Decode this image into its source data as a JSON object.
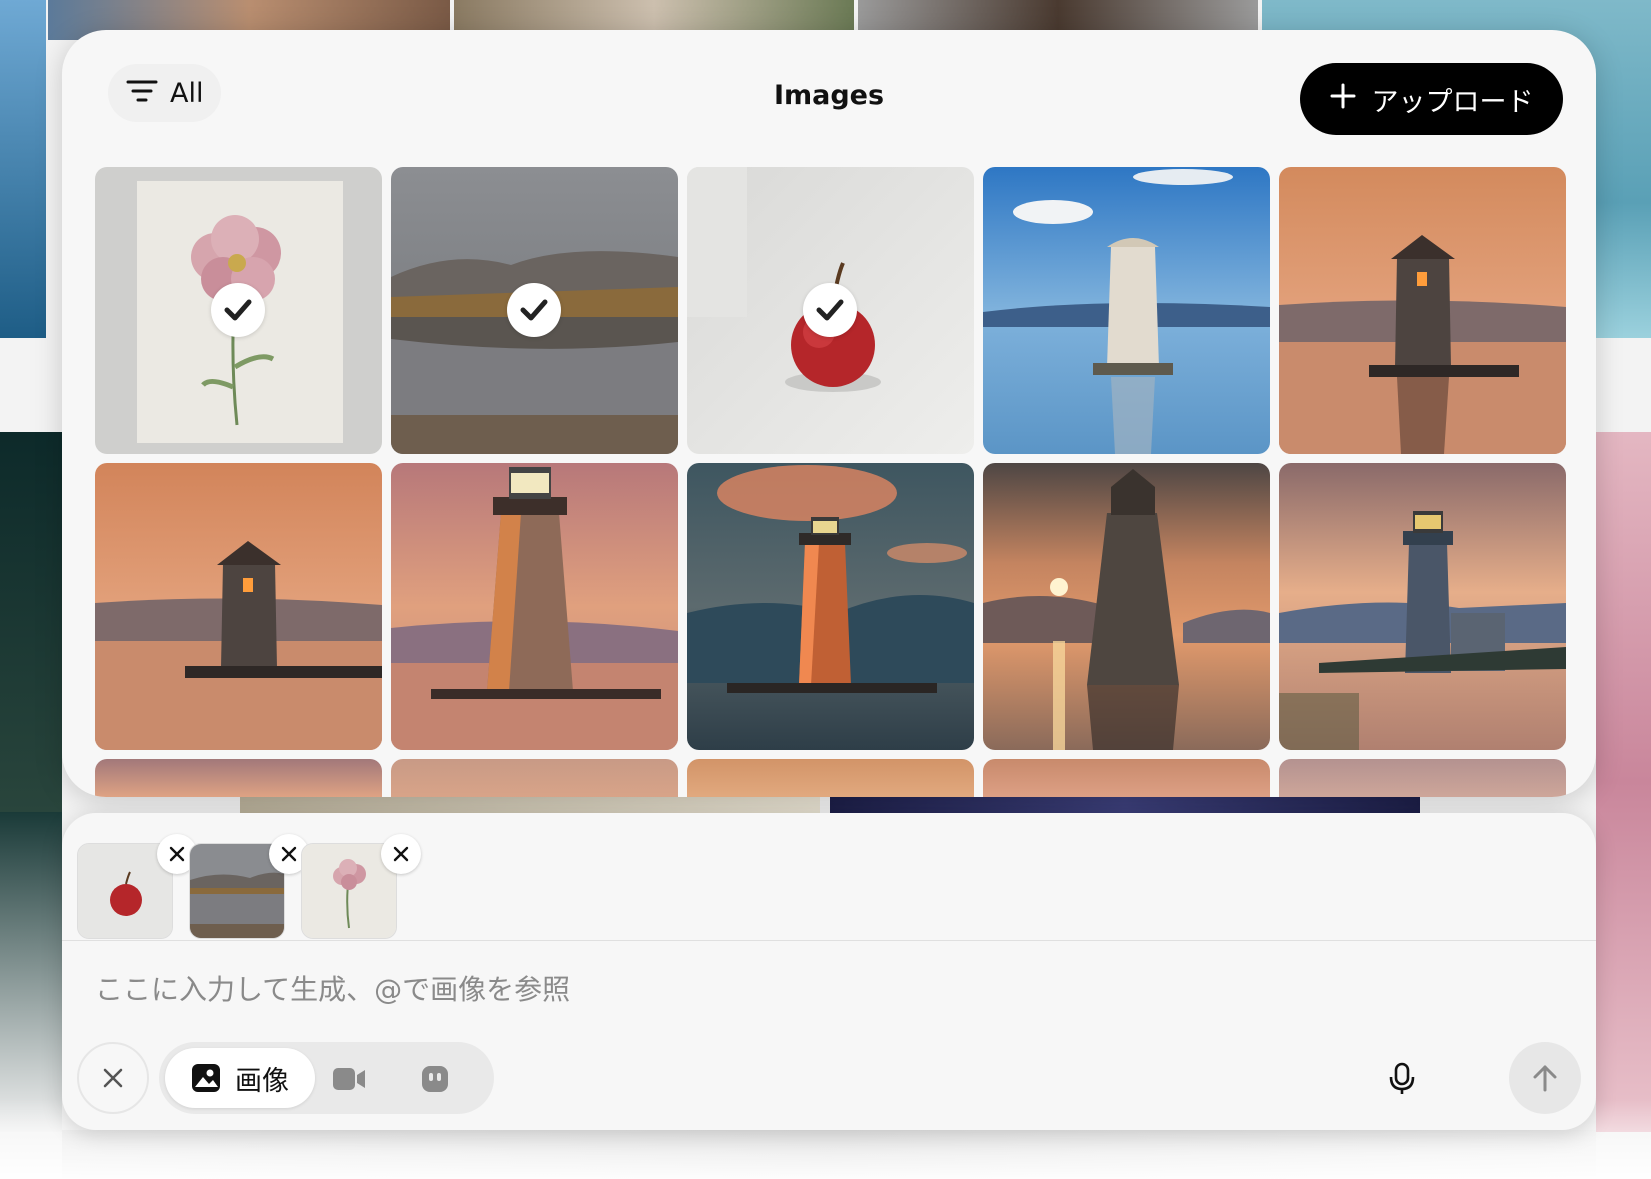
{
  "gallery": {
    "filter_label": "All",
    "title": "Images",
    "upload_label": "アップロード",
    "items": [
      {
        "subject": "watercolor flower",
        "selected": true
      },
      {
        "subject": "mountain lake reflection",
        "selected": true
      },
      {
        "subject": "red apple",
        "selected": true
      },
      {
        "subject": "lighthouse blue sky",
        "selected": false
      },
      {
        "subject": "stone tower sunset",
        "selected": false
      },
      {
        "subject": "stone tower sunset",
        "selected": false
      },
      {
        "subject": "lighthouse sunset",
        "selected": false
      },
      {
        "subject": "lighthouse dusk",
        "selected": false
      },
      {
        "subject": "lighthouse setting sun",
        "selected": false
      },
      {
        "subject": "lighthouse island",
        "selected": false
      }
    ]
  },
  "composer": {
    "attachments": [
      {
        "subject": "red apple"
      },
      {
        "subject": "mountain lake reflection"
      },
      {
        "subject": "watercolor flower"
      }
    ],
    "prompt_placeholder": "ここに入力して生成、@で画像を参照",
    "mode_image_label": "画像",
    "icons": [
      "close-icon",
      "image-icon",
      "video-icon",
      "character-icon",
      "mic-icon",
      "arrow-up-icon"
    ]
  },
  "colors": {
    "upload_bg": "#000000",
    "panel_bg": "#f7f7f7",
    "check_color": "#222222"
  }
}
